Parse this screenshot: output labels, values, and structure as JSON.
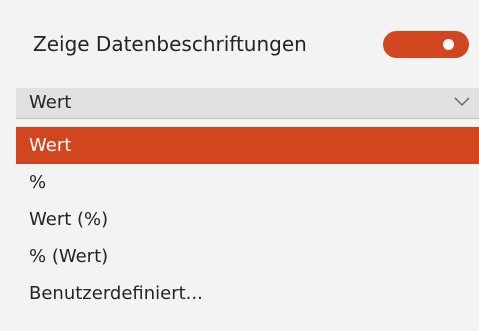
{
  "toggle": {
    "label": "Zeige Datenbeschriftungen",
    "state": "on",
    "color": "#d2461f"
  },
  "dropdown": {
    "selected_value": "Wert",
    "icon": "chevron-down-icon"
  },
  "options": [
    {
      "label": "Wert",
      "selected": true
    },
    {
      "label": "%",
      "selected": false
    },
    {
      "label": "Wert (%)",
      "selected": false
    },
    {
      "label": "% (Wert)",
      "selected": false
    },
    {
      "label": "Benutzerdefiniert...",
      "selected": false
    }
  ],
  "colors": {
    "accent": "#d2461f",
    "background": "#f3f3f3",
    "dropdown_background": "#e1e1e1"
  }
}
